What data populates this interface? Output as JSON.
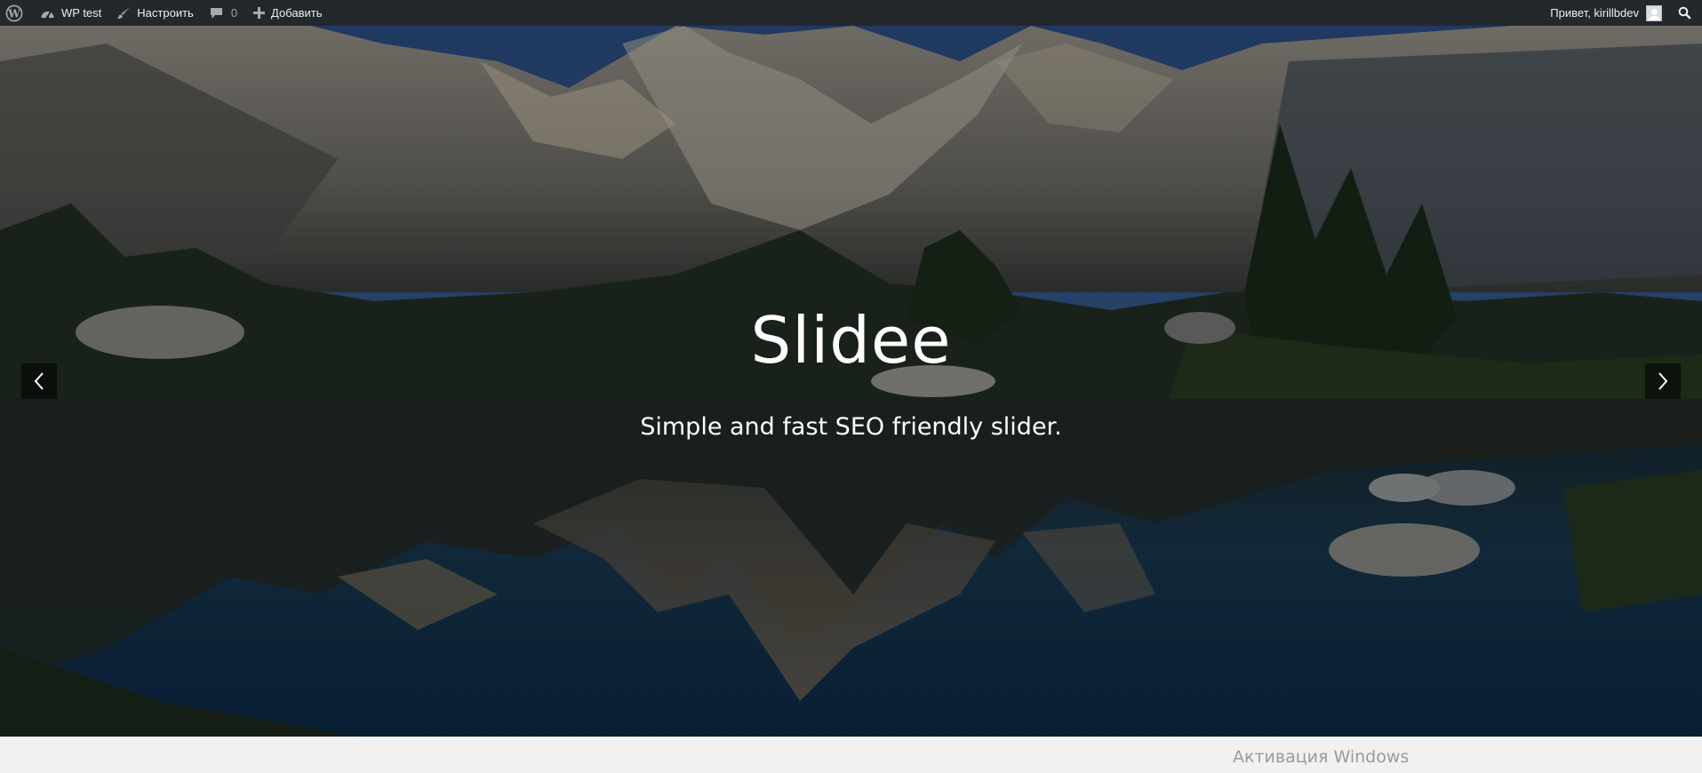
{
  "adminbar": {
    "site_name": "WP test",
    "customize_label": "Настроить",
    "comments_count": "0",
    "new_label": "Добавить",
    "greeting": "Привет, kirillbdev"
  },
  "slider": {
    "title": "Slidee",
    "description": "Simple and fast SEO friendly slider."
  },
  "watermark": "Активация Windows",
  "icons": [
    "wordpress-icon",
    "dashboard-icon",
    "brush-icon",
    "comment-icon",
    "plus-icon",
    "search-icon",
    "chevron-left-icon",
    "chevron-right-icon"
  ]
}
